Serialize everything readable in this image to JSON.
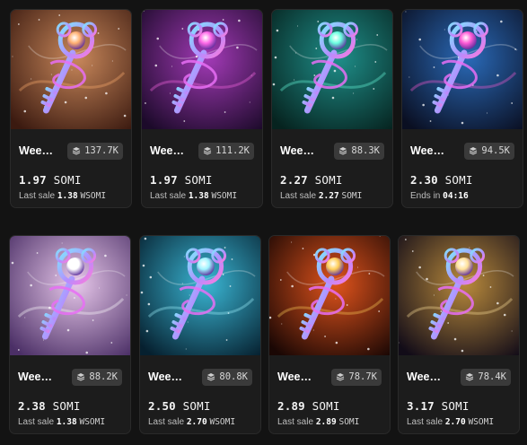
{
  "cards": [
    {
      "name": "Wee…",
      "volume": "137.7K",
      "price": "1.97",
      "currency": "SOMI",
      "sub_label": "Last sale",
      "sub_value": "1.38",
      "sub_unit": "WSOMI",
      "bg": [
        "#c9885b",
        "#3b1a10"
      ],
      "glow": "#ffb070",
      "icon": "key-art-desert"
    },
    {
      "name": "Wee…",
      "volume": "111.2K",
      "price": "1.97",
      "currency": "SOMI",
      "sub_label": "Last sale",
      "sub_value": "1.38",
      "sub_unit": "WSOMI",
      "bg": [
        "#a23ab6",
        "#1c0a2a"
      ],
      "glow": "#ff6ae8",
      "icon": "key-art-purple-nebula"
    },
    {
      "name": "Wee…",
      "volume": "88.3K",
      "price": "2.27",
      "currency": "SOMI",
      "sub_label": "Last sale",
      "sub_value": "2.27",
      "sub_unit": "SOMI",
      "bg": [
        "#1f8f8a",
        "#06231f"
      ],
      "glow": "#6bffe0",
      "icon": "key-art-teal-nebula"
    },
    {
      "name": "Wee…",
      "volume": "94.5K",
      "price": "2.30",
      "currency": "SOMI",
      "sub_label": "Ends in",
      "sub_value": "04:16",
      "sub_unit": "",
      "bg": [
        "#2a6ab8",
        "#0a0f22"
      ],
      "glow": "#ff5bd6",
      "icon": "key-art-blue-nebula"
    },
    {
      "name": "Wee…",
      "volume": "88.2K",
      "price": "2.38",
      "currency": "SOMI",
      "sub_label": "Last sale",
      "sub_value": "1.38",
      "sub_unit": "WSOMI",
      "bg": [
        "#e7c7ea",
        "#4b2f66"
      ],
      "glow": "#ffffff",
      "icon": "key-art-pastel"
    },
    {
      "name": "Wee…",
      "volume": "80.8K",
      "price": "2.50",
      "currency": "SOMI",
      "sub_label": "Last sale",
      "sub_value": "2.70",
      "sub_unit": "WSOMI",
      "bg": [
        "#3ab6d4",
        "#06202f"
      ],
      "glow": "#a0f4ff",
      "icon": "key-art-cyan-galaxy"
    },
    {
      "name": "Wee…",
      "volume": "78.7K",
      "price": "2.89",
      "currency": "SOMI",
      "sub_label": "Last sale",
      "sub_value": "2.89",
      "sub_unit": "SOMI",
      "bg": [
        "#e0531c",
        "#1a0704"
      ],
      "glow": "#ffcf5a",
      "icon": "key-art-fire"
    },
    {
      "name": "Wee…",
      "volume": "78.4K",
      "price": "3.17",
      "currency": "SOMI",
      "sub_label": "Last sale",
      "sub_value": "2.70",
      "sub_unit": "WSOMI",
      "bg": [
        "#b98a3c",
        "#120c18"
      ],
      "glow": "#ffe29a",
      "icon": "key-art-gold-swirl"
    }
  ]
}
